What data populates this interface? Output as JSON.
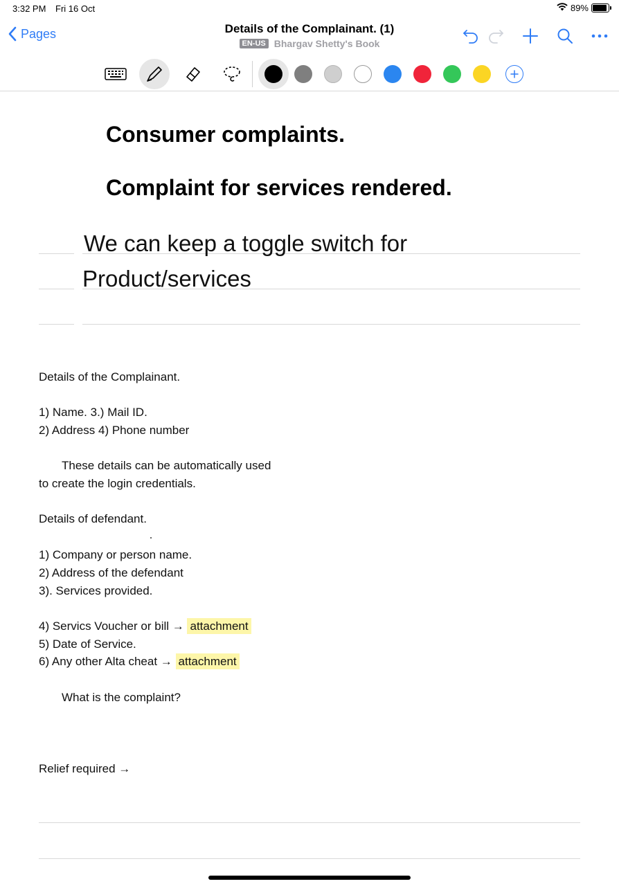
{
  "status_bar": {
    "time": "3:32 PM",
    "date": "Fri 16 Oct",
    "battery": "89%"
  },
  "nav": {
    "back_label": "Pages",
    "title": "Details of the Complainant. (1)",
    "lang": "EN-US",
    "notebook": "Bhargav Shetty's Book",
    "actions": [
      "undo-icon",
      "redo-icon",
      "add-icon",
      "search-icon",
      "more-icon"
    ]
  },
  "toolbar": {
    "tools": [
      "keyboard-icon",
      "pen-icon",
      "eraser-icon",
      "lasso-icon"
    ],
    "active_tool": "pen-icon",
    "colors": [
      "#000000",
      "#7f7f7f",
      "#cfcfcf",
      "#ffffff",
      "#2b86f0",
      "#f0243a",
      "#34c759",
      "#fbd524"
    ],
    "selected_color": "#000000"
  },
  "document": {
    "heading_1": "Consumer complaints.",
    "heading_2": "Complaint for services rendered.",
    "handwriting": [
      "We can keep a toggle switch for",
      "Product/services"
    ],
    "complainant_title": "Details of the Complainant.",
    "complainant_items": [
      "1)   Name. 3.) Mail ID.",
      "2)   Address 4) Phone number"
    ],
    "note_line_1": "These details can be automatically used",
    "note_line_2": "to create the login credentials.",
    "defendant_title": "Details of defendant.",
    "defendant_items": [
      "1)   Company or person name.",
      "2)   Address of the defendant",
      "3).  Services provided."
    ],
    "item_4_text": "4)   Servics Voucher or bill →",
    "item_4_highlight": "attachment",
    "item_5_text": "5)   Date of Service.",
    "item_6_text": "6)   Any other Alta cheat →",
    "item_6_highlight": "attachment",
    "complaint_question": "What is the complaint?",
    "relief": "Relief required →"
  }
}
